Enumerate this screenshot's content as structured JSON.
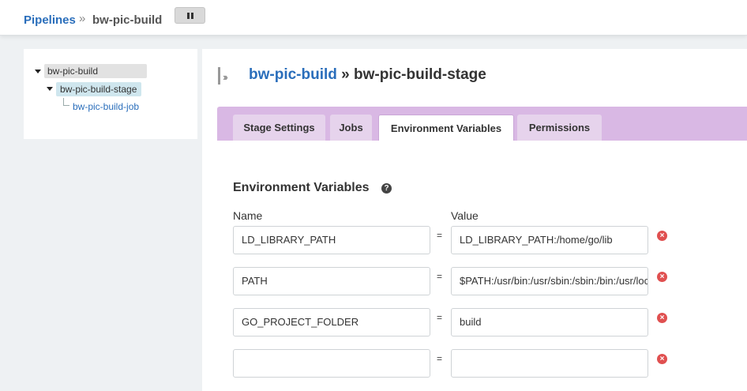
{
  "breadcrumb": {
    "root": "Pipelines",
    "separator": "»",
    "current": "bw-pic-build"
  },
  "pause_button": {
    "icon": "pause-icon"
  },
  "tree": {
    "pipeline": "bw-pic-build",
    "stage": "bw-pic-build-stage",
    "job": "bw-pic-build-job"
  },
  "header": {
    "pipeline_link": "bw-pic-build",
    "separator": "»",
    "stage_name": "bw-pic-build-stage"
  },
  "tabs": [
    {
      "label": "Stage Settings",
      "active": false
    },
    {
      "label": "Jobs",
      "active": false
    },
    {
      "label": "Environment Variables",
      "active": true
    },
    {
      "label": "Permissions",
      "active": false
    }
  ],
  "env_section": {
    "title": "Environment Variables",
    "help_glyph": "?",
    "name_label": "Name",
    "value_label": "Value",
    "equals": "=",
    "remove_glyph": "×",
    "rows": [
      {
        "name": "LD_LIBRARY_PATH",
        "value": "LD_LIBRARY_PATH:/home/go/lib"
      },
      {
        "name": "PATH",
        "value": "$PATH:/usr/bin:/usr/sbin:/sbin:/bin:/usr/local/bin"
      },
      {
        "name": "GO_PROJECT_FOLDER",
        "value": "build"
      },
      {
        "name": "",
        "value": ""
      }
    ]
  }
}
